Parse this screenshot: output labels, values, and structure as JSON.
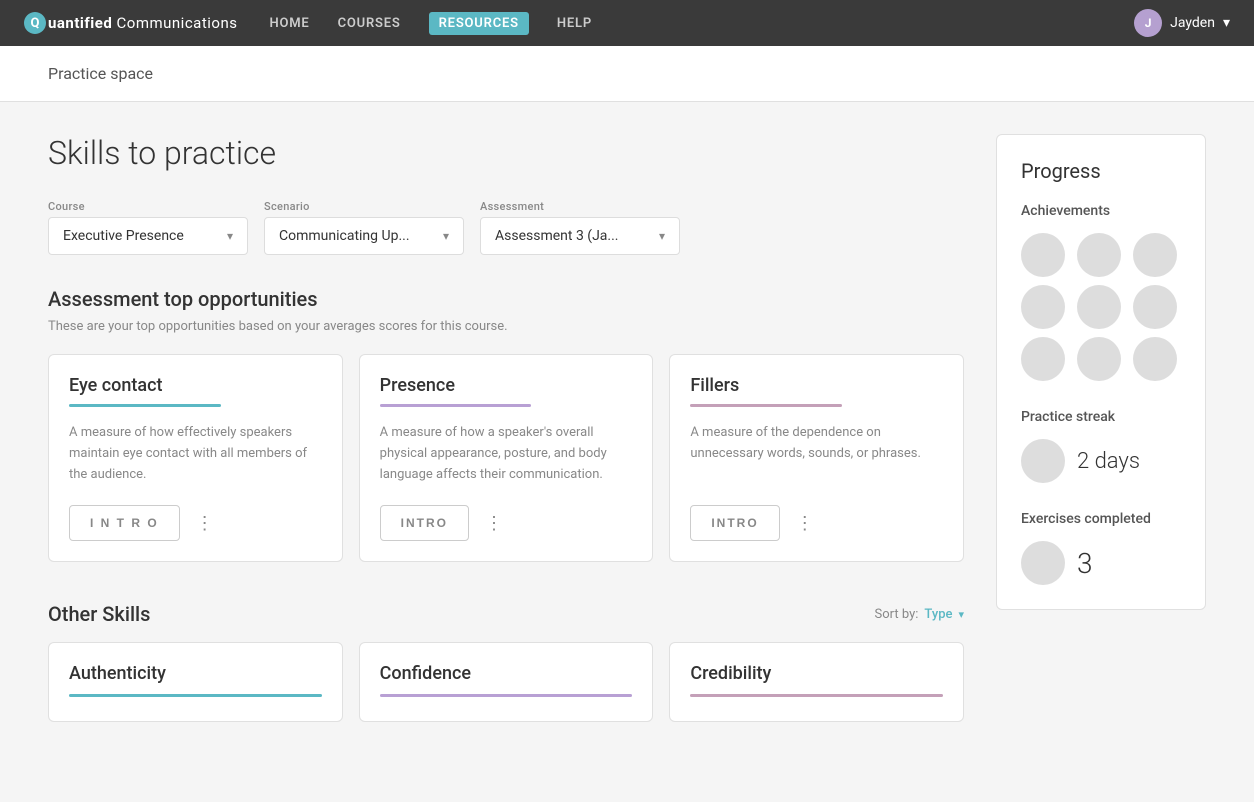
{
  "brand": {
    "q_letter": "Q",
    "name_bold": "uantified ",
    "name_rest": "Communications"
  },
  "nav": {
    "home": "HOME",
    "courses": "COURSES",
    "resources": "RESOURCES",
    "help": "HELP",
    "user": "Jayden"
  },
  "breadcrumb": "Practice space",
  "page_title": "Skills to practice",
  "filters": {
    "course_label": "Course",
    "course_value": "Executive Presence",
    "scenario_label": "Scenario",
    "scenario_value": "Communicating Up...",
    "assessment_label": "Assessment",
    "assessment_value": "Assessment 3 (Ja..."
  },
  "top_opportunities": {
    "title": "Assessment top opportunities",
    "subtitle": "These are your top opportunities based on your averages scores for this course.",
    "cards": [
      {
        "title": "Eye contact",
        "bar_color": "#5bb8c4",
        "description": "A measure of how effectively speakers maintain eye contact with all members of the audience.",
        "intro_label": "I N T R O"
      },
      {
        "title": "Presence",
        "bar_color": "#b8a0d4",
        "description": "A measure of how a speaker's overall physical appearance, posture, and body language affects their communication.",
        "intro_label": "INTRO"
      },
      {
        "title": "Fillers",
        "bar_color": "#c4a0b8",
        "description": "A measure of the dependence on unnecessary words, sounds, or phrases.",
        "intro_label": "INTRO"
      }
    ]
  },
  "other_skills": {
    "title": "Other Skills",
    "sort_label": "Sort by:",
    "sort_value": "Type",
    "cards": [
      {
        "title": "Authenticity",
        "bar_color": "#5bb8c4"
      },
      {
        "title": "Confidence",
        "bar_color": "#b8a0d4"
      },
      {
        "title": "Credibility",
        "bar_color": "#c4a0b8"
      }
    ]
  },
  "progress": {
    "title": "Progress",
    "achievements_title": "Achievements",
    "practice_streak_title": "Practice streak",
    "streak_value": "2 days",
    "exercises_title": "Exercises completed",
    "exercises_value": "3"
  },
  "more_icon": "⋮"
}
